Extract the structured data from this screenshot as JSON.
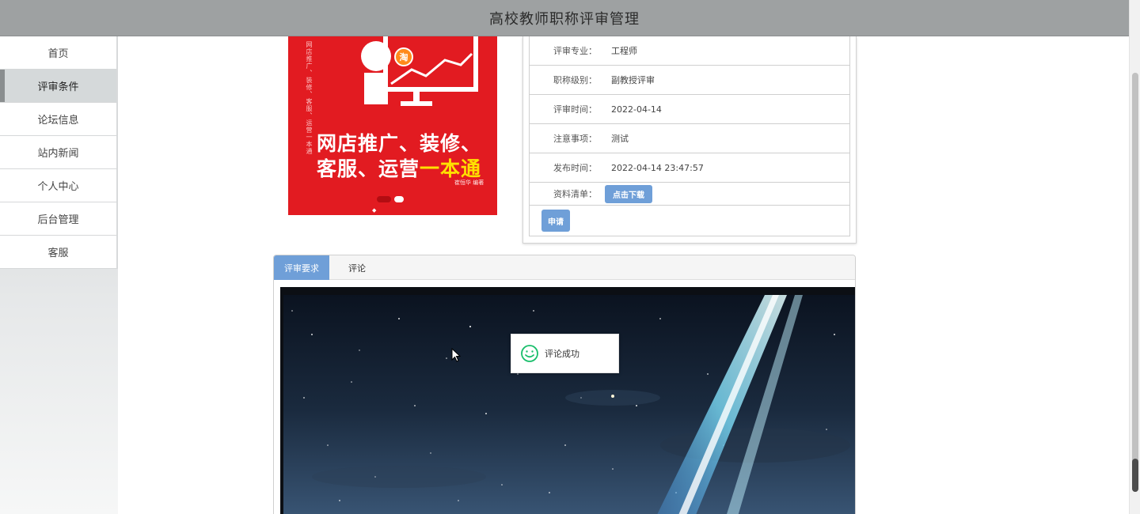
{
  "header": {
    "title": "高校教师职称评审管理"
  },
  "sidebar": {
    "items": [
      {
        "label": "首页",
        "active": false
      },
      {
        "label": "评审条件",
        "active": true
      },
      {
        "label": "论坛信息",
        "active": false
      },
      {
        "label": "站内新闻",
        "active": false
      },
      {
        "label": "个人中心",
        "active": false
      },
      {
        "label": "后台管理",
        "active": false
      },
      {
        "label": "客服",
        "active": false
      }
    ]
  },
  "book": {
    "badge": "淘",
    "title_line1": "网店推广、装修、",
    "title_line2_part1": "客服、运营",
    "title_line2_highlight": "一本通",
    "author": "崔恒华 编著",
    "spine": "网店推广、装修、客服、运营一本通"
  },
  "info": {
    "rows": [
      {
        "label": "评审专业：",
        "value": "工程师"
      },
      {
        "label": "职称级别：",
        "value": "副教授评审"
      },
      {
        "label": "评审时间：",
        "value": "2022-04-14"
      },
      {
        "label": "注意事项：",
        "value": "测试"
      },
      {
        "label": "发布时间：",
        "value": "2022-04-14 23:47:57"
      }
    ],
    "materials_label": "资料清单：",
    "download_label": "点击下载",
    "apply_label": "申请"
  },
  "tabs": [
    {
      "label": "评审要求",
      "active": true
    },
    {
      "label": "评论",
      "active": false
    }
  ],
  "toast": {
    "text": "评论成功",
    "icon": "smiley-icon"
  },
  "colors": {
    "header_bg": "#9ea1a2",
    "accent": "#6f9fd8",
    "book_red": "#e21b21",
    "toast_icon": "#19be6b"
  }
}
